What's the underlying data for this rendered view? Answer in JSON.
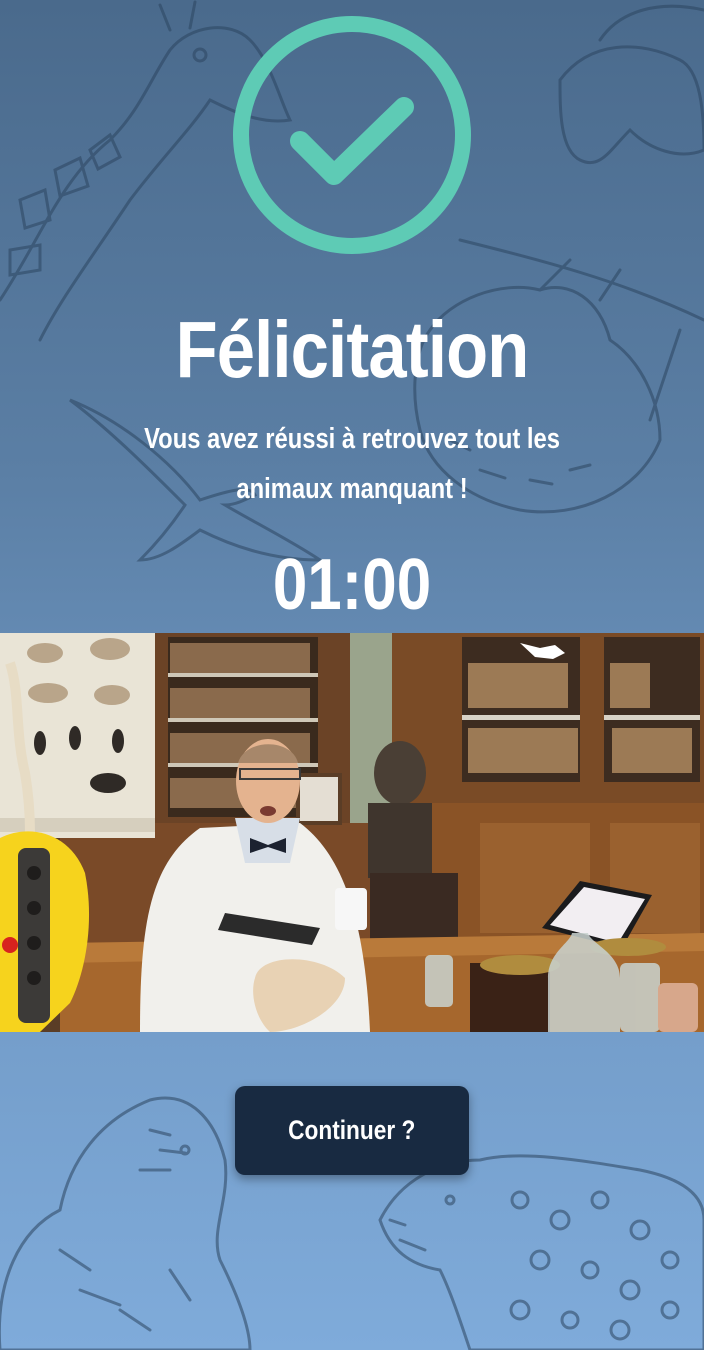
{
  "icons": {
    "success": "check-circle-icon",
    "success_color": "#5ecbb5"
  },
  "colors": {
    "background": "#5b7fa5",
    "button": "#182a41",
    "text": "#ffffff"
  },
  "result": {
    "title": "Félicitation",
    "message": "Vous avez réussi à retrouvez tout les animaux manquant !",
    "timer": "01:00"
  },
  "actions": {
    "continue_label": "Continuer ?"
  }
}
